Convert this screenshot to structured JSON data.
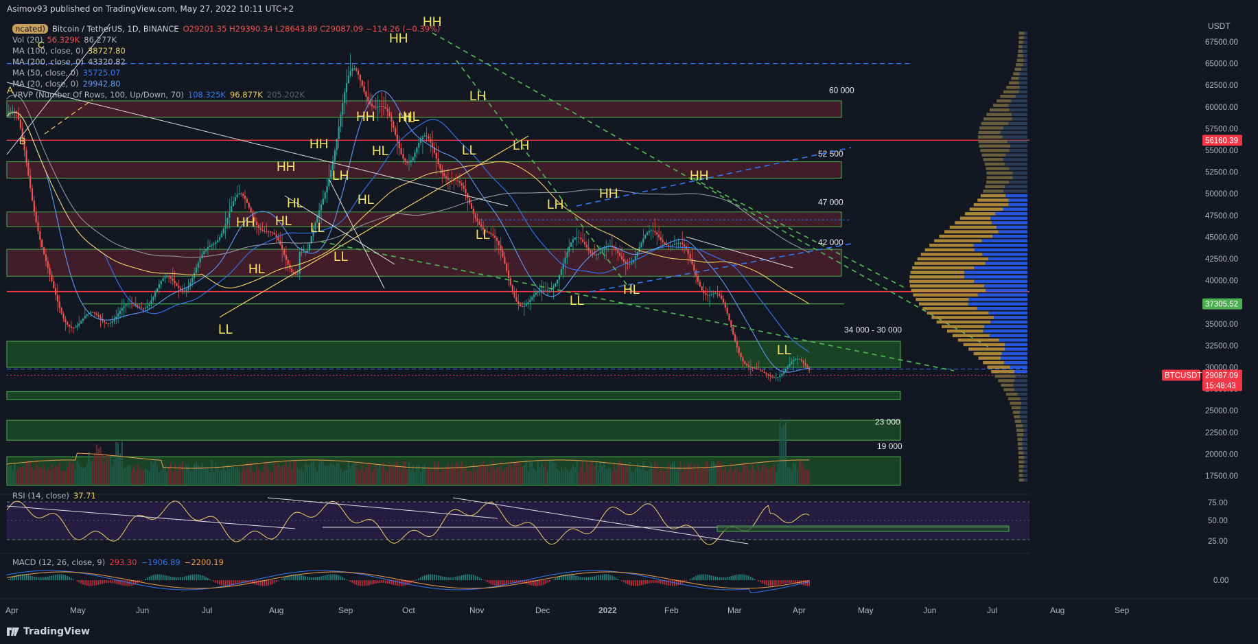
{
  "header": {
    "published": "Asimov93 published on TradingView.com, May 27, 2022 10:11 UTC+2"
  },
  "symbol": {
    "title": "Bitcoin / TetherUS, 1D, BINANCE",
    "ohlc": "O29201.35  H29390.34  L28643.89  C29087.09  −114.26 (−0.39%)",
    "badge": "ncated)"
  },
  "indicators": [
    {
      "name": "Vol (20)",
      "values": [
        "56.329K",
        "86.277K"
      ],
      "colors": [
        "#ef5350",
        "#b2b5be"
      ]
    },
    {
      "name": "MA (100, close, 0)",
      "values": [
        "38727.80"
      ],
      "colors": [
        "#f0d060"
      ]
    },
    {
      "name": "MA (200, close, 0)",
      "values": [
        "43320.82"
      ],
      "colors": [
        "#b2b5be"
      ]
    },
    {
      "name": "MA (50, close, 0)",
      "values": [
        "35725.07"
      ],
      "colors": [
        "#3179f5"
      ]
    },
    {
      "name": "MA (20, close, 0)",
      "values": [
        "29942.80"
      ],
      "colors": [
        "#5b9cf6"
      ]
    },
    {
      "name": "VRVP (Number Of Rows, 100, Up/Down, 70)",
      "values": [
        "108.325K",
        "96.877K",
        "205.202K"
      ],
      "colors": [
        "#3179f5",
        "#f0d060",
        "#5d606b"
      ]
    }
  ],
  "price_axis": {
    "currency": "USDT",
    "ticks": [
      "67500.00",
      "65000.00",
      "62500.00",
      "60000.00",
      "57500.00",
      "55000.00",
      "52500.00",
      "50000.00",
      "47500.00",
      "45000.00",
      "42500.00",
      "40000.00",
      "37500.00",
      "35000.00",
      "32500.00",
      "30000.00",
      "27500.00",
      "25000.00",
      "22500.00",
      "20000.00",
      "17500.00"
    ],
    "badges": [
      {
        "text": "56160.39",
        "color": "#f23645"
      },
      {
        "text": "37305.52",
        "color": "#4caf50"
      },
      {
        "text": "BTCUSDT",
        "color": "#f23645"
      },
      {
        "text": "29087.09",
        "color": "#f23645"
      },
      {
        "text": "15:48:43",
        "color": "#f23645"
      }
    ]
  },
  "time_axis": [
    "Apr",
    "May",
    "Jun",
    "Jul",
    "Aug",
    "Sep",
    "Oct",
    "Nov",
    "Dec",
    "2022",
    "Feb",
    "Mar",
    "Apr",
    "May",
    "Jun",
    "Jul",
    "Aug",
    "Sep"
  ],
  "zone_labels": [
    "60 000",
    "52 500",
    "47 000",
    "42 000",
    "34 000 - 30 000",
    "23 000",
    "19 000"
  ],
  "annotations": [
    "HH",
    "HH",
    "HH",
    "HH",
    "HH",
    "HH",
    "HH",
    "HH",
    "HL",
    "HL",
    "HL",
    "HL",
    "HL",
    "HL",
    "HL",
    "HL",
    "LH",
    "LH",
    "LH",
    "LH",
    "LL",
    "LL",
    "LL",
    "LL",
    "LL",
    "LL",
    "LL",
    "A",
    "B",
    "C"
  ],
  "rsi": {
    "label": "RSI (14, close)",
    "value": "37.71",
    "ticks": [
      "75.00",
      "50.00",
      "25.00"
    ]
  },
  "macd": {
    "label": "MACD (12, 26, close, 9)",
    "values": [
      "293.30",
      "−1906.89",
      "−2200.19"
    ],
    "colors": [
      "#f23645",
      "#3179f5",
      "#f0a04b"
    ],
    "ticks": [
      "0.00"
    ]
  },
  "footer": {
    "brand": "TradingView"
  },
  "chart_data": {
    "type": "candlestick",
    "title": "Bitcoin / TetherUS, 1D, BINANCE",
    "x": [
      "2021-04",
      "2021-05",
      "2021-06",
      "2021-07",
      "2021-08",
      "2021-09",
      "2021-10",
      "2021-11",
      "2021-12",
      "2022-01",
      "2022-02",
      "2022-03",
      "2022-04",
      "2022-05"
    ],
    "close": [
      57000,
      37000,
      35000,
      41500,
      47000,
      43500,
      61000,
      57000,
      46500,
      38500,
      43200,
      45500,
      38500,
      29087
    ],
    "high": [
      64800,
      59500,
      41300,
      42400,
      50500,
      52900,
      67000,
      69000,
      59000,
      48000,
      45800,
      48200,
      47400,
      40000
    ],
    "low": [
      47000,
      30000,
      28800,
      29300,
      37300,
      39600,
      43300,
      53200,
      42000,
      33100,
      34300,
      37200,
      37500,
      26700
    ],
    "ylim": [
      16000,
      70000
    ],
    "horizontal_levels": [
      65000,
      56160.39,
      38727.8,
      37305.52,
      29087.09
    ],
    "zones": [
      {
        "label": "60 000",
        "from": 58800,
        "to": 60700,
        "color": "#4a1e2a"
      },
      {
        "label": "52 500",
        "from": 51800,
        "to": 53700,
        "color": "#4a1e2a"
      },
      {
        "label": "47 000",
        "from": 46200,
        "to": 47900,
        "color": "#4a1e2a"
      },
      {
        "label": "42 000",
        "from": 40500,
        "to": 43600,
        "color": "#4a1e2a"
      },
      {
        "label": "34 000 - 30 000",
        "from": 30000,
        "to": 33000,
        "color": "#1c4a25"
      },
      {
        "label": "",
        "from": 26300,
        "to": 27200,
        "color": "#1c4a25"
      },
      {
        "label": "23 000",
        "from": 21600,
        "to": 23900,
        "color": "#1c4a25"
      },
      {
        "label": "19 000",
        "from": 16400,
        "to": 19700,
        "color": "#1c4a25"
      }
    ]
  }
}
